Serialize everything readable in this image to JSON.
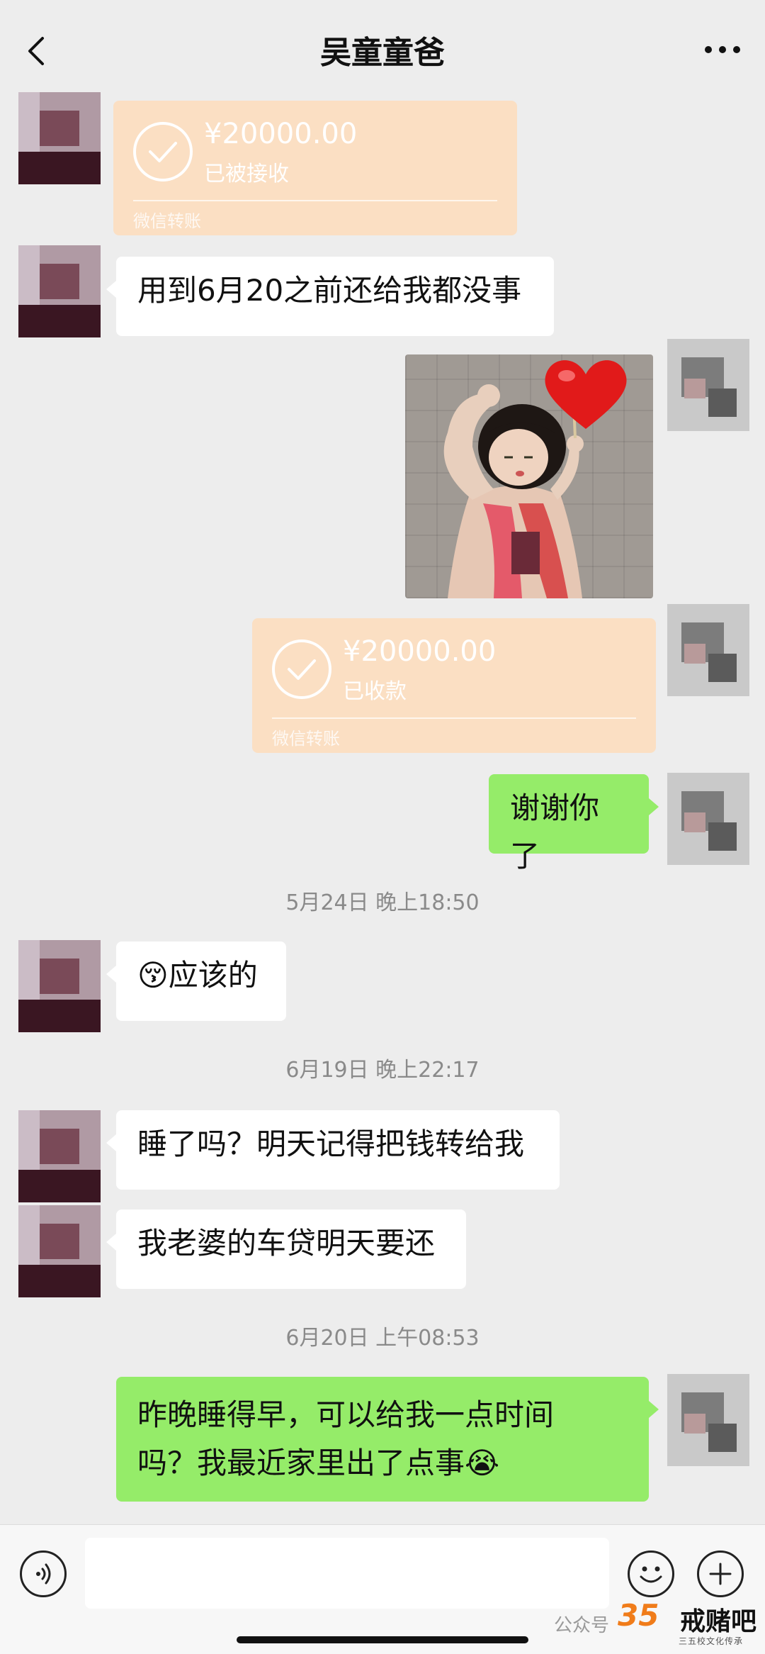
{
  "header": {
    "title": "吴童童爸"
  },
  "transfers": [
    {
      "amount": "¥20000.00",
      "status": "已被接收",
      "label": "微信转账"
    },
    {
      "amount": "¥20000.00",
      "status": "已收款",
      "label": "微信转账"
    }
  ],
  "messages": {
    "m1": "用到6月20之前还给我都没事",
    "m2": "谢谢你了",
    "m3_text": "应该的",
    "m3_emoji": "😚",
    "m4": "睡了吗？明天记得把钱转给我",
    "m5": "我老婆的车贷明天要还",
    "m6_line1": "昨晚睡得早，可以给我一点时间",
    "m6_line2": "吗？我最近家里出了点事",
    "m6_emoji": "😭"
  },
  "timestamps": {
    "t1": "5月24日 晚上18:50",
    "t2": "6月19日 晚上22:17",
    "t3": "6月20日 上午08:53"
  },
  "watermark": {
    "text": "公众号",
    "logo": "35",
    "brand": "戒赌吧",
    "sub": "三五校文化传承"
  },
  "icons": {
    "back": "chevron-left-icon",
    "more": "more-dots-icon",
    "voice": "voice-icon",
    "emoji": "emoji-icon",
    "plus": "plus-icon",
    "heart": "heart-icon",
    "check": "check-icon"
  },
  "colors": {
    "background": "#ededed",
    "outgoing_bubble": "#95ec69",
    "incoming_bubble": "#ffffff",
    "transfer_card": "#fbdfc3",
    "timestamp_text": "#8a8a8a"
  }
}
